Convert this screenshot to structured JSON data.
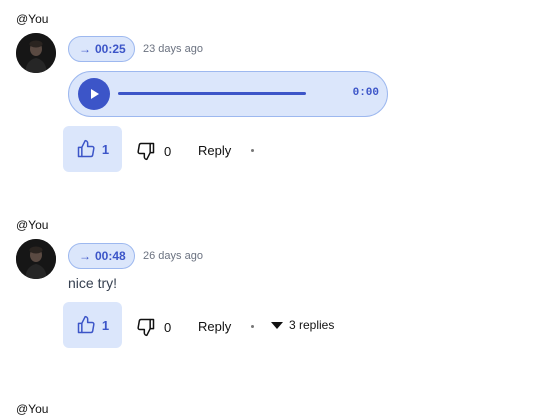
{
  "comments": [
    {
      "author": "@You",
      "timestamp": "00:25",
      "ago": "23 days ago",
      "audio_time": "0:00",
      "likes": "1",
      "dislikes": "0",
      "reply_label": "Reply"
    },
    {
      "author": "@You",
      "timestamp": "00:48",
      "ago": "26 days ago",
      "text": "nice try!",
      "likes": "1",
      "dislikes": "0",
      "reply_label": "Reply",
      "replies_label": "3 replies"
    },
    {
      "author": "@You"
    }
  ],
  "icons": {
    "timestamp": "arrow-right-icon",
    "play": "play-icon",
    "like": "thumbs-up-icon",
    "dislike": "thumbs-down-icon",
    "replies": "caret-down-icon"
  },
  "colors": {
    "accent": "#3c55c8",
    "accent_bg": "#dbe6fb",
    "accent_border": "#9db8ef"
  }
}
